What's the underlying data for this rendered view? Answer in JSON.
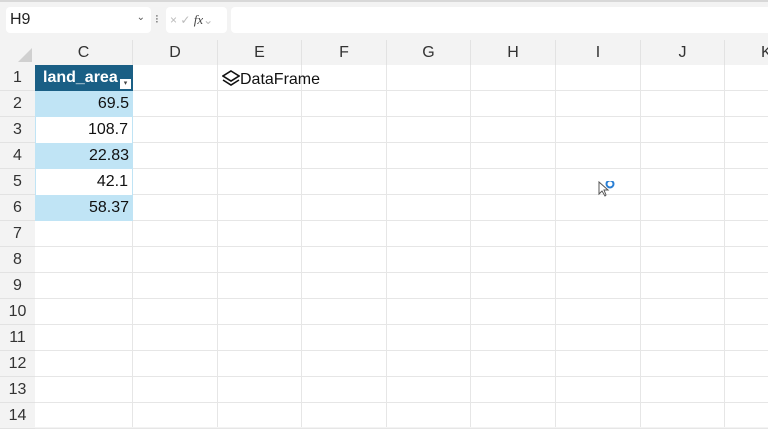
{
  "formula_bar": {
    "name_box": "H9",
    "fx_label": "fx",
    "cancel": "×",
    "enter": "✓",
    "formula": ""
  },
  "columns": [
    "C",
    "D",
    "E",
    "F",
    "G",
    "H",
    "I",
    "J",
    "K"
  ],
  "rows": [
    "1",
    "2",
    "3",
    "4",
    "5",
    "6",
    "7",
    "8",
    "9",
    "10",
    "11",
    "12",
    "13",
    "14"
  ],
  "table": {
    "header": "land_area",
    "values": [
      "69.5",
      "108.7",
      "22.83",
      "42.1",
      "58.37"
    ]
  },
  "dataframe_label": "DataFrame",
  "colors": {
    "header": "#1a5f85",
    "band": "#c0e4f5"
  }
}
